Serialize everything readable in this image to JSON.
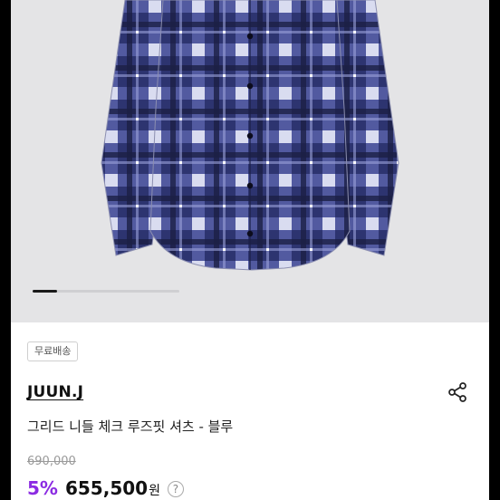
{
  "product": {
    "image_icon": "plaid-shirt-image",
    "carousel": {
      "current": 1,
      "total": 6
    },
    "badge": "무료배송",
    "brand": "JUUN.J",
    "share_icon": "share-icon",
    "title": "그리드 니들 체크 루즈핏 셔츠 - 블루",
    "original_price": "690,000",
    "discount": "5%",
    "price": "655,500",
    "currency": "원",
    "help_icon": "question-circle-icon",
    "help_glyph": "?"
  },
  "colors": {
    "accent": "#8b2be2",
    "hero_bg": "#e4e4e6"
  }
}
